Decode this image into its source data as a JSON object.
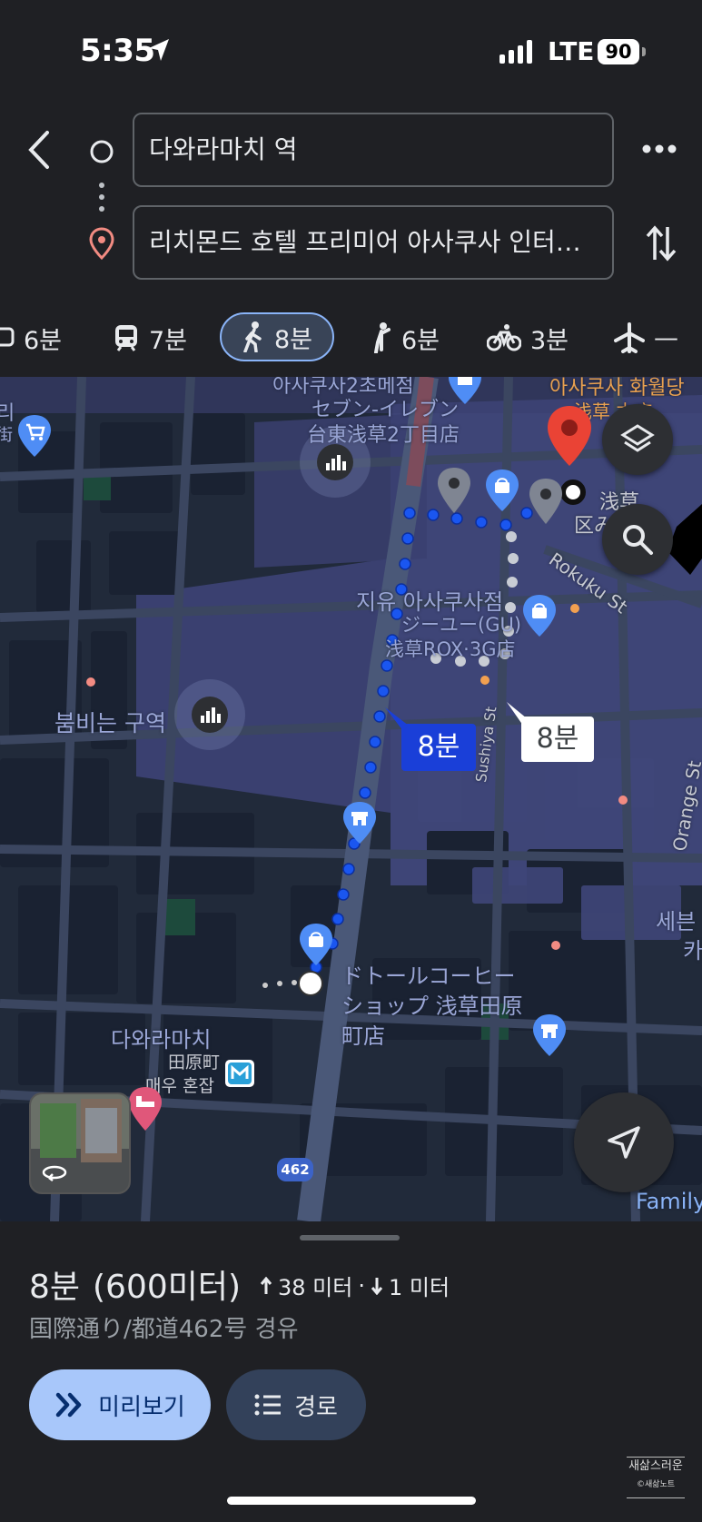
{
  "status_bar": {
    "time": "5:35",
    "network": "LTE",
    "battery": "90"
  },
  "directions": {
    "origin": "다와라마치 역",
    "destination": "리치몬드 호텔 프리미어 아사쿠사 인터…"
  },
  "modes": [
    {
      "icon": "car-icon",
      "label": "6분"
    },
    {
      "icon": "transit-icon",
      "label": "7분"
    },
    {
      "icon": "walk-icon",
      "label": "8분",
      "selected": true
    },
    {
      "icon": "ride-icon",
      "label": "6분"
    },
    {
      "icon": "bike-icon",
      "label": "3분"
    },
    {
      "icon": "plane-icon",
      "label": "—"
    }
  ],
  "map": {
    "labels": {
      "asakusa_top": "아사쿠사2초메점",
      "seven_eleven": "セブン-イレブン",
      "seven_eleven_2": "台東浅草2丁目店",
      "asakusa_hanayashiki": "아사쿠사 화월당",
      "asakusa_honten": "浅草 本店",
      "asakusa_area": "浅草",
      "area_kanji": "区み",
      "rokuku": "Rokuku St",
      "gu_ko": "지유 아사쿠사점",
      "gu_jp": "ジーユー(GU)",
      "gu_jp2": "浅草ROX·3G店",
      "busy_area": "붐비는 구역",
      "sushiya": "Sushiya St",
      "orange_st": "Orange St",
      "seven_ko": "세븐",
      "seven_ko2": "카",
      "doutor": "ドトールコーヒー",
      "doutor2": "ショップ 浅草田原",
      "doutor3": "町店",
      "tawaramachi": "다와라마치",
      "tawaramachi_jp": "田原町",
      "crowded": "매우 혼잡",
      "family": "Family",
      "route_shield": "462",
      "left_edge": "리",
      "left_edge2": "街"
    },
    "walk_callout": "8분",
    "alt_callout": "8분"
  },
  "sheet": {
    "duration": "8분",
    "distance": "(600미터)",
    "ascent": "38 미터",
    "separator": "·",
    "descent": "1 미터",
    "via": "国際通り/都道462号 경유",
    "preview_label": "미리보기",
    "steps_label": "경로"
  },
  "watermark": {
    "line1": "새삶스러운",
    "line2": "©새삶노트"
  },
  "colors": {
    "route_blue": "#1a56f0",
    "accent": "#a8c7fa",
    "pin_red": "#ea4335"
  }
}
